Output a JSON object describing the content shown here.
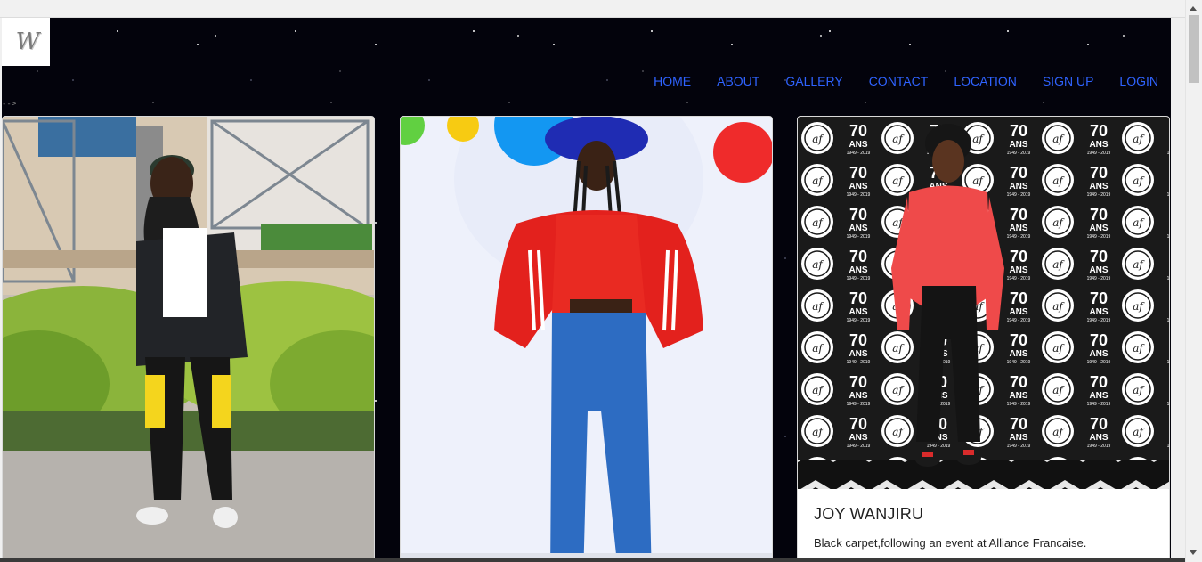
{
  "brand": {
    "logo_text": "W"
  },
  "nav": {
    "items": [
      "HOME",
      "ABOUT",
      "GALLERY",
      "CONTACT",
      "LOCATION",
      "SIGN UP",
      "LOGIN"
    ]
  },
  "stray_text": "-->",
  "cards": [
    {
      "image_alt": "woman in black jacket and bandana with yellow cargo straps",
      "title": "",
      "text": ""
    },
    {
      "image_alt": "woman in red sweatshirt, blue jeans and blue hat",
      "title": "",
      "text": ""
    },
    {
      "image_alt": "woman in red top at Alliance Francaise 70 ans backdrop",
      "title": "JOY WANJIRU",
      "text": "Black carpet,following an event at Alliance Francaise."
    }
  ],
  "backdrop": {
    "badge_big": "70",
    "badge_small": "ANS",
    "badge_years": "1949 - 2019",
    "badge_logo": "af"
  },
  "colors": {
    "nav_link": "#2f63ff",
    "page_bg": "#02020a"
  }
}
